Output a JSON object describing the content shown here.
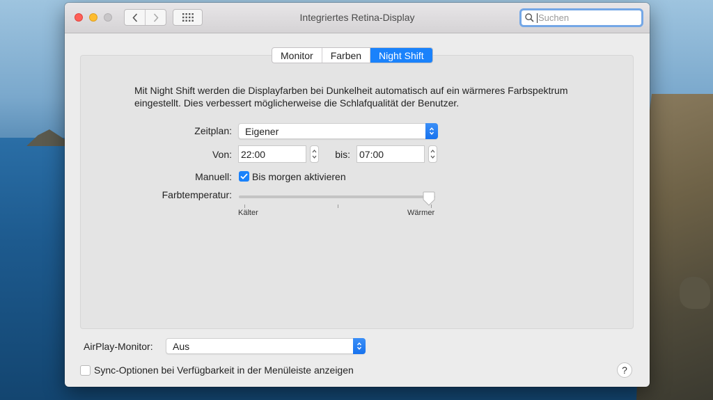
{
  "window": {
    "title": "Integriertes Retina-Display",
    "search_placeholder": "Suchen"
  },
  "toolbar": {
    "back_icon": "chevron-left-icon",
    "forward_icon": "chevron-right-icon",
    "grid_icon": "grid-icon"
  },
  "tabs": [
    {
      "label": "Monitor",
      "active": false
    },
    {
      "label": "Farben",
      "active": false
    },
    {
      "label": "Night Shift",
      "active": true
    }
  ],
  "night_shift": {
    "description": "Mit Night Shift werden die Displayfarben bei Dunkelheit automatisch auf ein wärmeres Farbspektrum eingestellt. Dies verbessert möglicherweise die Schlafqualität der Benutzer.",
    "schedule_label": "Zeitplan:",
    "schedule_value": "Eigener",
    "from_label": "Von:",
    "from_value": "22:00",
    "to_label": "bis:",
    "to_value": "07:00",
    "manual_label": "Manuell:",
    "manual_checkbox_label": "Bis morgen aktivieren",
    "manual_checked": true,
    "temperature_label": "Farbtemperatur:",
    "temperature_level": 1.0,
    "cooler_label": "Kälter",
    "warmer_label": "Wärmer"
  },
  "footer": {
    "airplay_label": "AirPlay-Monitor:",
    "airplay_value": "Aus",
    "sync_label": "Sync-Optionen bei Verfügbarkeit in der Menüleiste anzeigen",
    "sync_checked": false,
    "help_label": "?"
  },
  "colors": {
    "accent": "#1a82fb",
    "close": "#ff5f57",
    "minimize": "#febc2e"
  }
}
